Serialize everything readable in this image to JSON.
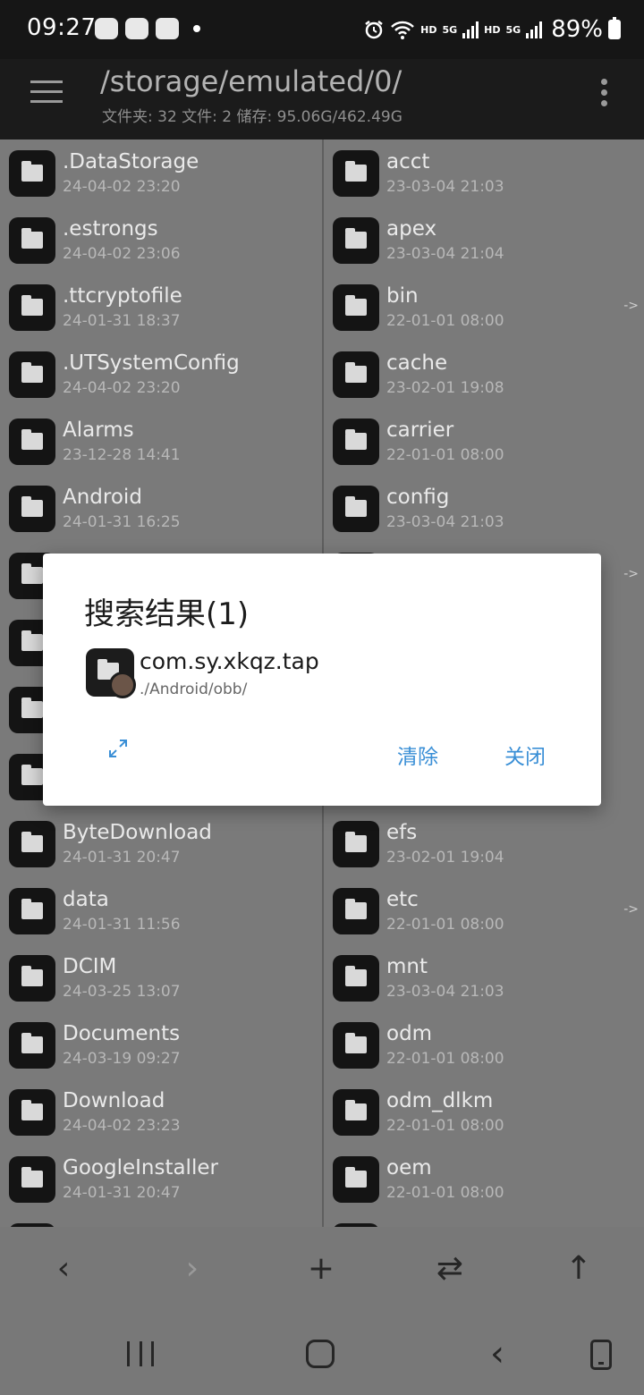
{
  "status_bar": {
    "time": "09:27",
    "battery_text": "89%",
    "network_1_label": "HD",
    "network_1_gen": "5G",
    "network_2_label": "HD",
    "network_2_gen": "5G",
    "icons": [
      "wechat-icon",
      "wechat-icon",
      "app-notification-icon",
      "dot-icon",
      "alarm-icon",
      "wifi-icon",
      "signal-icon",
      "signal-icon",
      "battery-icon"
    ]
  },
  "app_bar": {
    "path": "/storage/emulated/0/",
    "info": "文件夹: 32  文件: 2  储存: 95.06G/462.49G"
  },
  "left_pane": {
    "items": [
      {
        "name": ".DataStorage",
        "date": "24-04-02 23:20"
      },
      {
        "name": ".estrongs",
        "date": "24-04-02 23:06"
      },
      {
        "name": ".ttcryptofile",
        "date": "24-01-31 18:37"
      },
      {
        "name": ".UTSystemConfig",
        "date": "24-04-02 23:20"
      },
      {
        "name": "Alarms",
        "date": "23-12-28 14:41"
      },
      {
        "name": "Android",
        "date": "24-01-31 16:25"
      },
      {
        "name": "ByteDownload",
        "date": "24-01-31 20:47"
      },
      {
        "name": "data",
        "date": "24-01-31 11:56"
      },
      {
        "name": "DCIM",
        "date": "24-03-25 13:07"
      },
      {
        "name": "Documents",
        "date": "24-03-19 09:27"
      },
      {
        "name": "Download",
        "date": "24-04-02 23:23"
      },
      {
        "name": "GoogleInstaller",
        "date": "24-01-31 20:47"
      }
    ]
  },
  "right_pane": {
    "items": [
      {
        "name": "acct",
        "date": "23-03-04 21:03",
        "link": ""
      },
      {
        "name": "apex",
        "date": "23-03-04 21:04",
        "link": ""
      },
      {
        "name": "bin",
        "date": "22-01-01 08:00",
        "link": "->"
      },
      {
        "name": "cache",
        "date": "23-02-01 19:08",
        "link": ""
      },
      {
        "name": "carrier",
        "date": "22-01-01 08:00",
        "link": ""
      },
      {
        "name": "config",
        "date": "23-03-04 21:03",
        "link": ""
      },
      {
        "name": "efs",
        "date": "23-02-01 19:04",
        "link": ""
      },
      {
        "name": "etc",
        "date": "22-01-01 08:00",
        "link": "->"
      },
      {
        "name": "mnt",
        "date": "23-03-04 21:03",
        "link": ""
      },
      {
        "name": "odm",
        "date": "22-01-01 08:00",
        "link": ""
      },
      {
        "name": "odm_dlkm",
        "date": "22-01-01 08:00",
        "link": ""
      },
      {
        "name": "oem",
        "date": "22-01-01 08:00",
        "link": ""
      }
    ],
    "hidden_link_marker": "->"
  },
  "dialog": {
    "title": "搜索结果(1)",
    "result": {
      "name": "com.sy.xkqz.tap",
      "path": "./Android/obb/"
    },
    "clear_label": "清除",
    "close_label": "关闭"
  },
  "toolbar": {
    "back_glyph": "‹",
    "forward_glyph": "›",
    "add_glyph": "+",
    "swap_glyph": "⇄",
    "up_glyph": "↑"
  },
  "nav_bar": {
    "back_glyph": "‹"
  }
}
